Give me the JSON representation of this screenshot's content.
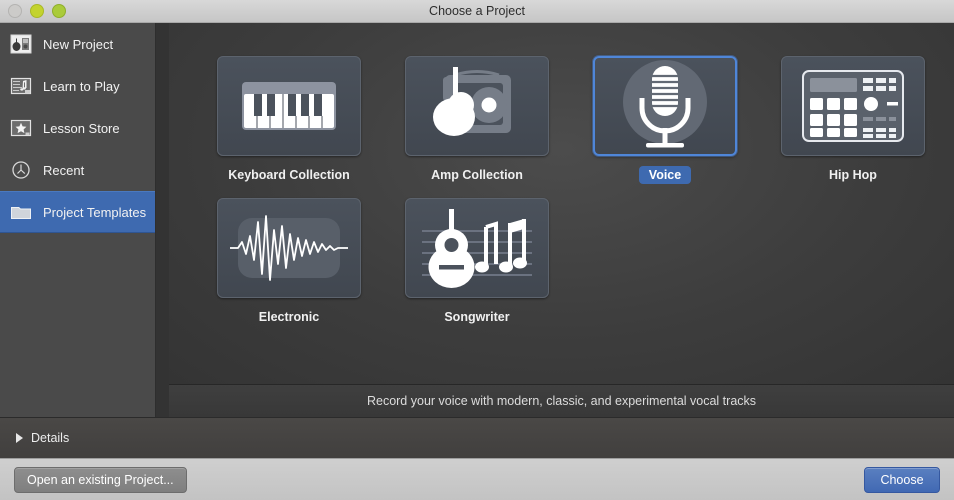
{
  "window": {
    "title": "Choose a Project",
    "traffic_lights": [
      {
        "name": "close-button",
        "color": "#cccbc9"
      },
      {
        "name": "minimize-button",
        "color": "#c3d32e"
      },
      {
        "name": "maximize-button",
        "color": "#aacb3a"
      }
    ]
  },
  "sidebar": {
    "items": [
      {
        "label": "New Project",
        "icon": "guitar-amp-icon",
        "selected": false
      },
      {
        "label": "Learn to Play",
        "icon": "music-note-board-icon",
        "selected": false
      },
      {
        "label": "Lesson Store",
        "icon": "star-board-icon",
        "selected": false
      },
      {
        "label": "Recent",
        "icon": "clock-icon",
        "selected": false
      },
      {
        "label": "Project Templates",
        "icon": "folder-icon",
        "selected": true
      }
    ],
    "selected_color": "#3e6ab0"
  },
  "main": {
    "templates": [
      {
        "label": "Keyboard Collection",
        "icon": "piano-keyboard-icon",
        "selected": false
      },
      {
        "label": "Amp Collection",
        "icon": "guitar-amp-icon",
        "selected": false
      },
      {
        "label": "Voice",
        "icon": "microphone-icon",
        "selected": true
      },
      {
        "label": "Hip Hop",
        "icon": "drum-machine-icon",
        "selected": false
      },
      {
        "label": "Electronic",
        "icon": "waveform-icon",
        "selected": false
      },
      {
        "label": "Songwriter",
        "icon": "acoustic-guitar-notes-icon",
        "selected": false
      }
    ],
    "description": "Record your voice with modern, classic, and experimental vocal tracks",
    "selection_color": "#4f86d8"
  },
  "details": {
    "label": "Details",
    "expanded": false
  },
  "footer": {
    "open_existing_label": "Open an existing Project...",
    "choose_label": "Choose",
    "choose_color": "#4169b3"
  }
}
